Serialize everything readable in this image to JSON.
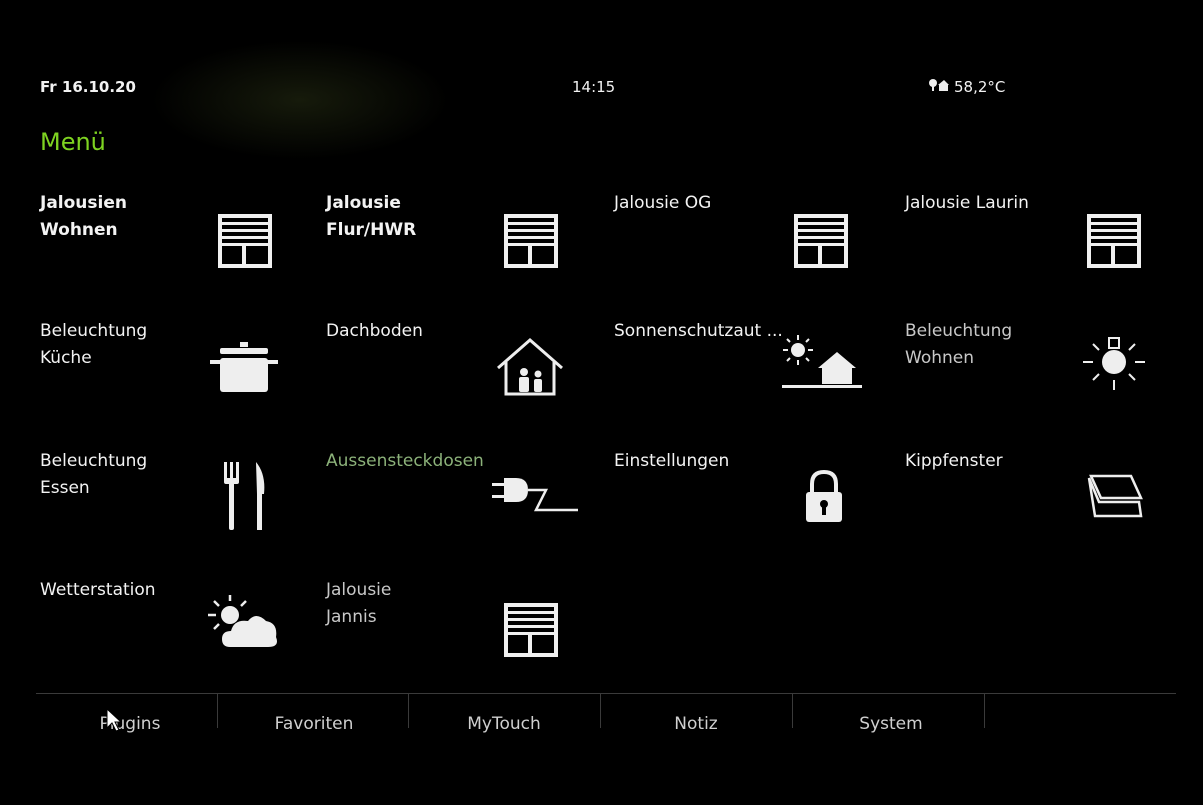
{
  "status": {
    "date": "Fr 16.10.20",
    "time": "14:15",
    "temperature": "58,2°C",
    "weather_icon": "tree-house-icon"
  },
  "menu": {
    "title": "Menü"
  },
  "tiles": [
    {
      "label": "Jalousien\nWohnen",
      "icon": "blind-icon"
    },
    {
      "label": "Jalousie\nFlur/HWR",
      "icon": "blind-icon"
    },
    {
      "label": "Jalousie OG",
      "icon": "blind-icon"
    },
    {
      "label": "Jalousie Laurin",
      "icon": "blind-icon"
    },
    {
      "label": "Beleuchtung\nKüche",
      "icon": "cooking-pot-icon"
    },
    {
      "label": "Dachboden",
      "icon": "house-family-icon"
    },
    {
      "label": "Sonnenschutzaut ...",
      "icon": "sun-house-icon"
    },
    {
      "label": "Beleuchtung\nWohnen",
      "icon": "light-bulb-icon"
    },
    {
      "label": "Beleuchtung\nEssen",
      "icon": "fork-knife-icon"
    },
    {
      "label": "Aussensteckdosen",
      "icon": "plug-icon"
    },
    {
      "label": "Einstellungen",
      "icon": "lock-icon"
    },
    {
      "label": "Kippfenster",
      "icon": "tilt-window-icon"
    },
    {
      "label": "Wetterstation",
      "icon": "sun-cloud-icon"
    },
    {
      "label": "Jalousie\nJannis",
      "icon": "blind-icon"
    }
  ],
  "nav": {
    "tabs": [
      "Plugins",
      "Favoriten",
      "MyTouch",
      "Notiz",
      "System"
    ]
  },
  "colors": {
    "accent": "#7ed321",
    "background": "#000000",
    "text": "#f3f3f3"
  }
}
